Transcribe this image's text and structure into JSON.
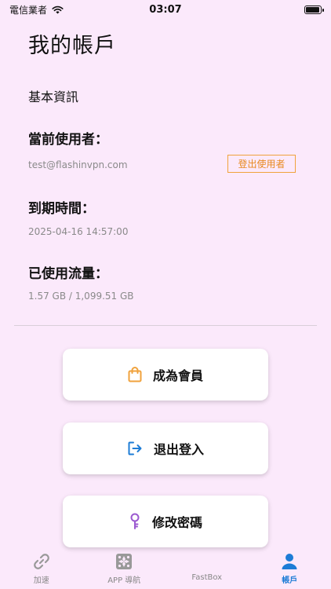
{
  "status_bar": {
    "carrier": "電信業者",
    "time": "03:07"
  },
  "page": {
    "title": "我的帳戶",
    "section_title": "基本資訊"
  },
  "account": {
    "current_user_label": "當前使用者：",
    "current_user_value": "test@flashinvpn.com",
    "logout_small_label": "登出使用者",
    "expiry_label": "到期時間：",
    "expiry_value": "2025-04-16 14:57:00",
    "traffic_label": "已使用流量：",
    "traffic_value": "1.57 GB / 1,099.51 GB"
  },
  "actions": {
    "become_member": {
      "label": "成為會員",
      "icon": "shopping-bag-icon",
      "color": "#f0a23c"
    },
    "logout": {
      "label": "退出登入",
      "icon": "logout-icon",
      "color": "#1d7cd6"
    },
    "change_password": {
      "label": "修改密碼",
      "icon": "key-icon",
      "color": "#9b59d0"
    }
  },
  "tabs": [
    {
      "label": "加速",
      "icon": "link-icon",
      "active": false
    },
    {
      "label": "APP 導航",
      "icon": "nav-grid-icon",
      "active": false
    },
    {
      "label": "FastBox",
      "icon": "fastbox-icon",
      "active": false
    },
    {
      "label": "帳戶",
      "icon": "person-icon",
      "active": true
    }
  ],
  "colors": {
    "background": "#fbe9fb",
    "accent": "#1d7cd6",
    "orange": "#f0a23c",
    "muted": "#8a8a8a"
  }
}
